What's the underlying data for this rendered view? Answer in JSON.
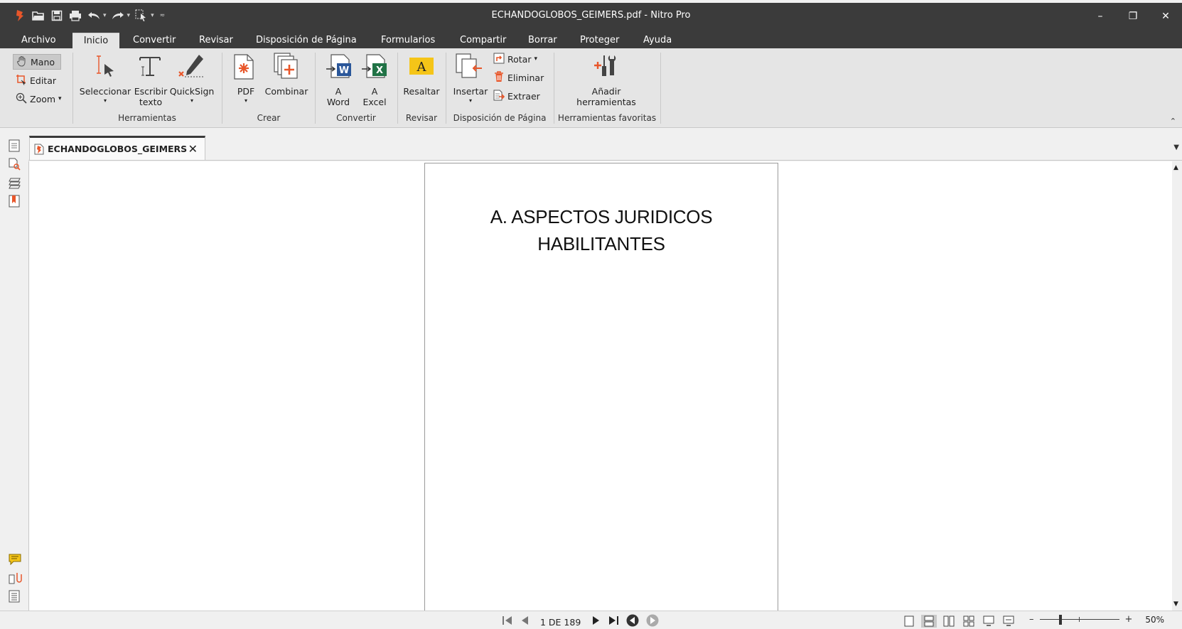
{
  "window": {
    "title": "ECHANDOGLOBOS_GEIMERS.pdf - Nitro Pro",
    "minimize": "–",
    "restore": "❐",
    "close": "✕"
  },
  "menu": {
    "tabs": [
      "Archivo",
      "Inicio",
      "Convertir",
      "Revisar",
      "Disposición de Página",
      "Formularios",
      "Compartir",
      "Borrar",
      "Proteger",
      "Ayuda"
    ],
    "active": "Inicio"
  },
  "ribbon": {
    "modes": {
      "hand": "Mano",
      "edit": "Editar",
      "zoom": "Zoom"
    },
    "tools": {
      "select": "Seleccionar",
      "type_line1": "Escribir",
      "type_line2": "texto",
      "quicksign": "QuickSign",
      "group": "Herramientas"
    },
    "create": {
      "pdf": "PDF",
      "combine": "Combinar",
      "group": "Crear"
    },
    "convert": {
      "word_line1": "A",
      "word_line2": "Word",
      "excel_line1": "A",
      "excel_line2": "Excel",
      "group": "Convertir"
    },
    "review": {
      "highlight": "Resaltar",
      "group": "Revisar"
    },
    "layout": {
      "insert": "Insertar",
      "rotate": "Rotar",
      "delete": "Eliminar",
      "extract": "Extraer",
      "group": "Disposición de Página"
    },
    "favorites": {
      "add_line1": "Añadir",
      "add_line2": "herramientas",
      "group": "Herramientas favoritas"
    }
  },
  "document": {
    "tab_title": "ECHANDOGLOBOS_GEIMERS",
    "heading_line1": "A.   ASPECTOS JURIDICOS",
    "heading_line2": "HABILITANTES"
  },
  "status": {
    "page_indicator": "1 DE 189",
    "zoom_minus": "–",
    "zoom_plus": "+",
    "zoom": "50%",
    "zoom_fraction": 0.25
  },
  "colors": {
    "titlebar": "#3b3b3b",
    "ribbon": "#e5e5e5",
    "accent_orange": "#e8562a",
    "word_blue": "#2b579a",
    "excel_green": "#217346",
    "highlight_yellow": "#f5c518"
  }
}
